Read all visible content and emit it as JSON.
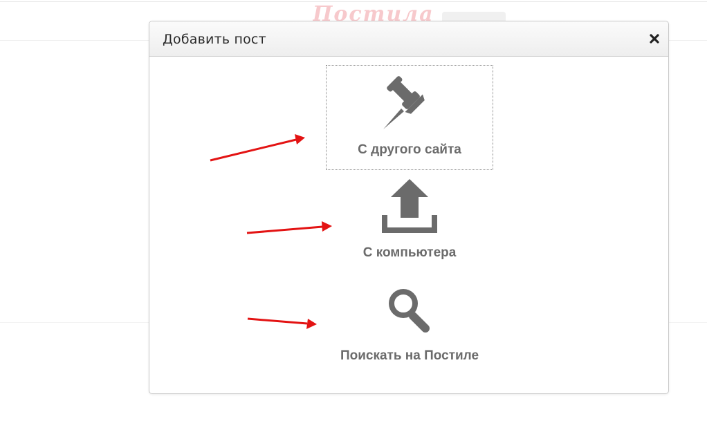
{
  "modal": {
    "title": "Добавить пост",
    "close_symbol": "✖"
  },
  "options": [
    {
      "label": "С другого сайта",
      "icon": "pushpin-icon"
    },
    {
      "label": "С компьютера",
      "icon": "upload-icon"
    },
    {
      "label": "Поискать на Постиле",
      "icon": "search-icon"
    }
  ],
  "colors": {
    "icon": "#6b6b6b",
    "label": "#6b6b6b",
    "arrow": "#e31313",
    "modal_border": "#c9c9c9",
    "logo": "#f7c9cc"
  }
}
